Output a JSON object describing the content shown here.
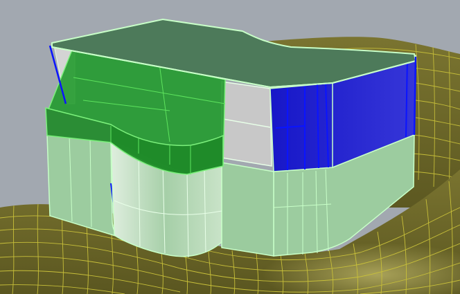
{
  "viewport": {
    "colors": {
      "background": "#a2a8b0",
      "terrain_fill": "#6e6a2c",
      "terrain_grid": "#c8c03a",
      "roof_fill": "#4d7a5a",
      "wall_light": "#9fcfa2",
      "wall_light_alt": "#b4dcb5",
      "selected_green": "#1f9a2a",
      "selected_blue": "#2c2ccc",
      "glass": "#c6c6c6",
      "edge_highlight": "#c8ffc8",
      "edge_selected_blue": "#0a14ff"
    },
    "objects": [
      {
        "name": "terrain-surface",
        "selected": false
      },
      {
        "name": "building-roof-slab",
        "selected": false
      },
      {
        "name": "building-ground-floor",
        "selected": false
      },
      {
        "name": "building-upper-facade-green",
        "selected": true
      },
      {
        "name": "building-right-facade-blue",
        "selected": true
      },
      {
        "name": "building-glazing",
        "selected": false
      }
    ]
  }
}
